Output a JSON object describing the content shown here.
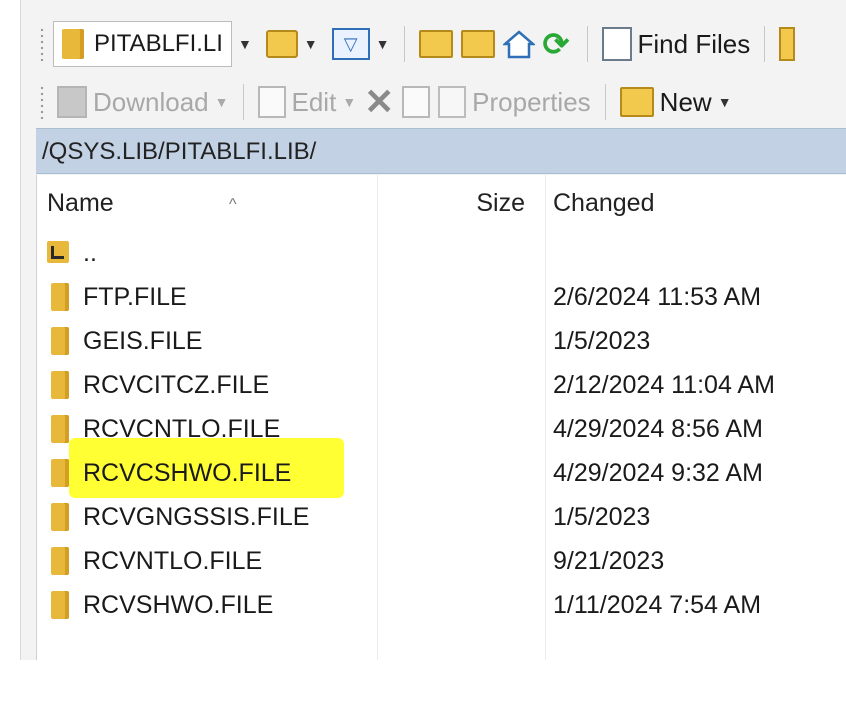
{
  "toolbar1": {
    "location_combo": "PITABLFI.LI",
    "find_files_label": "Find Files"
  },
  "toolbar2": {
    "download_label": "Download",
    "edit_label": "Edit",
    "properties_label": "Properties",
    "new_label": "New"
  },
  "path": "/QSYS.LIB/PITABLFI.LIB/",
  "columns": {
    "name": "Name",
    "size": "Size",
    "changed": "Changed"
  },
  "parent_dir": "..",
  "files": [
    {
      "name": "FTP.FILE",
      "changed": "2/6/2024 11:53 AM"
    },
    {
      "name": "GEIS.FILE",
      "changed": "1/5/2023"
    },
    {
      "name": "RCVCITCZ.FILE",
      "changed": "2/12/2024 11:04 AM"
    },
    {
      "name": "RCVCNTLO.FILE",
      "changed": "4/29/2024 8:56 AM"
    },
    {
      "name": "RCVCSHWO.FILE",
      "changed": "4/29/2024 9:32 AM"
    },
    {
      "name": "RCVGNGSSIS.FILE",
      "changed": "1/5/2023"
    },
    {
      "name": "RCVNTLO.FILE",
      "changed": "9/21/2023"
    },
    {
      "name": "RCVSHWO.FILE",
      "changed": "1/11/2024 7:54 AM"
    }
  ],
  "highlight_color": "#ffff33"
}
